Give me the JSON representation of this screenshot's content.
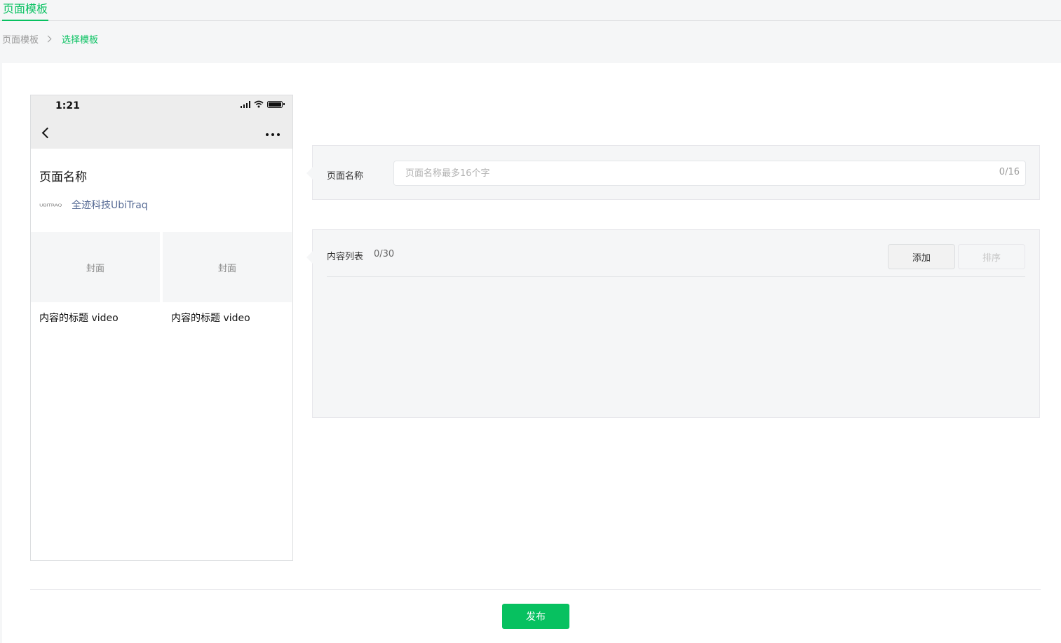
{
  "top_tab": {
    "label": "页面模板"
  },
  "breadcrumb": {
    "home": "页面模板",
    "current": "选择模板"
  },
  "phone_preview": {
    "status_time": "1:21",
    "page_title": "页面名称",
    "author_logo_text": "UBITRAQ",
    "author_name": "全迹科技UbiTraq",
    "items": [
      {
        "cover_label": "封面",
        "title": "内容的标题 video"
      },
      {
        "cover_label": "封面",
        "title": "内容的标题 video"
      }
    ],
    "icons": [
      "back-icon",
      "more-icon",
      "signal-icon",
      "wifi-icon",
      "battery-icon"
    ]
  },
  "page_name_panel": {
    "label": "页面名称",
    "placeholder": "页面名称最多16个字",
    "value": "",
    "counter": "0/16"
  },
  "content_panel": {
    "label": "内容列表",
    "counter": "0/30",
    "add_button": "添加",
    "sort_button": "排序"
  },
  "footer": {
    "publish_button": "发布"
  },
  "colors": {
    "accent": "#07c160",
    "link": "#576b95",
    "panel_bg": "#f5f6f7"
  }
}
